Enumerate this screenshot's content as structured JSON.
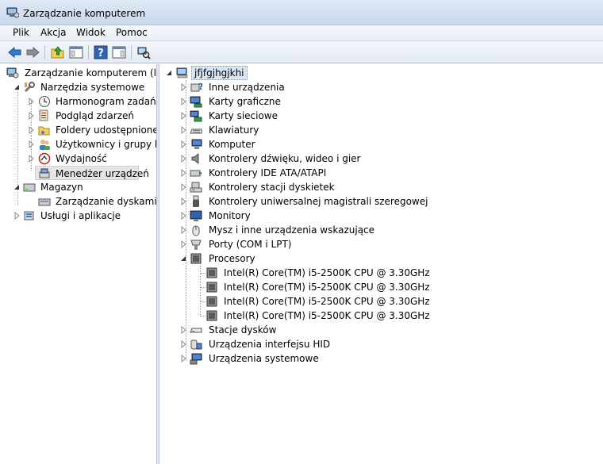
{
  "window": {
    "title": "Zarządzanie komputerem"
  },
  "menu": [
    "Plik",
    "Akcja",
    "Widok",
    "Pomoc"
  ],
  "toolbar": [
    "back-arrow-icon",
    "forward-arrow-icon",
    "up-folder-icon",
    "show-hide-tree-icon",
    "help-icon",
    "action-pane-icon",
    "scan-hardware-icon"
  ],
  "left_tree": {
    "root": "Zarządzanie komputerem (lokalny)",
    "system_tools": "Narzędzia systemowe",
    "task_scheduler": "Harmonogram zadań",
    "event_viewer": "Podgląd zdarzeń",
    "shared_folders": "Foldery udostępnione",
    "users_groups": "Użytkownicy i grupy lokalne",
    "performance": "Wydajność",
    "device_manager": "Menedżer urządzeń",
    "storage": "Magazyn",
    "disk_management": "Zarządzanie dyskami",
    "services_apps": "Usługi i aplikacje"
  },
  "device_tree": {
    "computer_name": "jfjfgjhgjkhi",
    "categories": [
      "Inne urządzenia",
      "Karty graficzne",
      "Karty sieciowe",
      "Klawiatury",
      "Komputer",
      "Kontrolery dźwięku, wideo i gier",
      "Kontrolery IDE ATA/ATAPI",
      "Kontrolery stacji dyskietek",
      "Kontrolery uniwersalnej magistrali szeregowej",
      "Monitory",
      "Mysz i inne urządzenia wskazujące",
      "Porty (COM i LPT)",
      "Procesory"
    ],
    "processors": [
      "Intel(R) Core(TM) i5-2500K CPU @ 3.30GHz",
      "Intel(R) Core(TM) i5-2500K CPU @ 3.30GHz",
      "Intel(R) Core(TM) i5-2500K CPU @ 3.30GHz",
      "Intel(R) Core(TM) i5-2500K CPU @ 3.30GHz"
    ],
    "after": [
      "Stacje dysków",
      "Urządzenia interfejsu HID",
      "Urządzenia systemowe"
    ]
  }
}
